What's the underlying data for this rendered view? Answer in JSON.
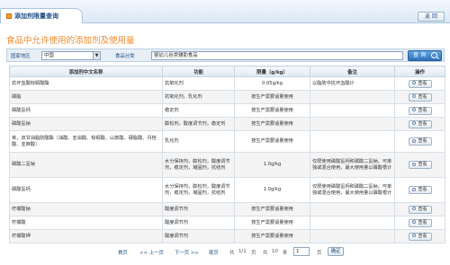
{
  "window": {
    "tab_title": "添加剂限量查询",
    "back_label": "返 回"
  },
  "heading": "食品中允许使用的添加剂及使用量",
  "search": {
    "country_label": "国家地区",
    "country_value": "中国",
    "category_label": "食品分类",
    "category_value": "婴幼儿谷类辅助食品",
    "button_label": "查 询"
  },
  "table": {
    "headers": [
      "添加剂中文名称",
      "功能",
      "限量（g/kg）",
      "备注",
      "操作"
    ],
    "view_label": "查看",
    "rows": [
      {
        "name": "抗坏血酸棕榈酸酯",
        "func": "抗氧化剂",
        "limit": "0.05g/kg",
        "note": "以脂肪中抗坏血酸计"
      },
      {
        "name": "磷脂",
        "func": "抗氧化剂，乳化剂",
        "limit": "按生产需要适量使用",
        "note": ""
      },
      {
        "name": "磷酸氢钙",
        "func": "稳定剂",
        "limit": "按生产需要适量使用",
        "note": ""
      },
      {
        "name": "磷酸氢钠",
        "func": "膨松剂，酸度调节剂，稳定剂",
        "limit": "按生产需要适量使用",
        "note": ""
      },
      {
        "name": "单，双甘油脂肪酸酯（油酸、亚油酸、棕榈酸、山嵛酸、硬脂酸、月桂酸、亚麻酸）",
        "func": "乳化剂",
        "limit": "按生产需要适量使用",
        "note": ""
      },
      {
        "name": "磷酸二氢钠",
        "func": "水分保持剂，膨松剂，酸度调节剂，稳定剂，凝固剂，抗结剂",
        "limit": "1.0g/kg",
        "note": "仅限使用磷酸氢钙和磷酸二氢钠，可单独或混合使用，最大使用量以磷酸根计"
      },
      {
        "name": "磷酸氢钙",
        "func": "水分保持剂，膨松剂，酸度调节剂，稳定剂，凝固剂，抗结剂",
        "limit": "1.0g/kg",
        "note": "仅限使用磷酸氢钙和磷酸二氢钠，可单独或混合使用，最大使用量以磷酸根计"
      },
      {
        "name": "柠檬酸钠",
        "func": "酸度调节剂",
        "limit": "按生产需要适量使用",
        "note": ""
      },
      {
        "name": "柠檬酸",
        "func": "酸度调节剂",
        "limit": "按生产需要适量使用",
        "note": ""
      },
      {
        "name": "柠檬酸钾",
        "func": "酸度调节剂",
        "limit": "按生产需要适量使用",
        "note": ""
      }
    ]
  },
  "pager": {
    "first": "首页",
    "prev": "<< 上一页",
    "next": "下一页 >>",
    "last": "尾页",
    "total": "共",
    "page_info": "1/1",
    "page_unit": "页",
    "count_total": "共",
    "count": "10",
    "count_unit": "条",
    "page_input": "1",
    "page_unit2": "页",
    "go": "确定"
  }
}
